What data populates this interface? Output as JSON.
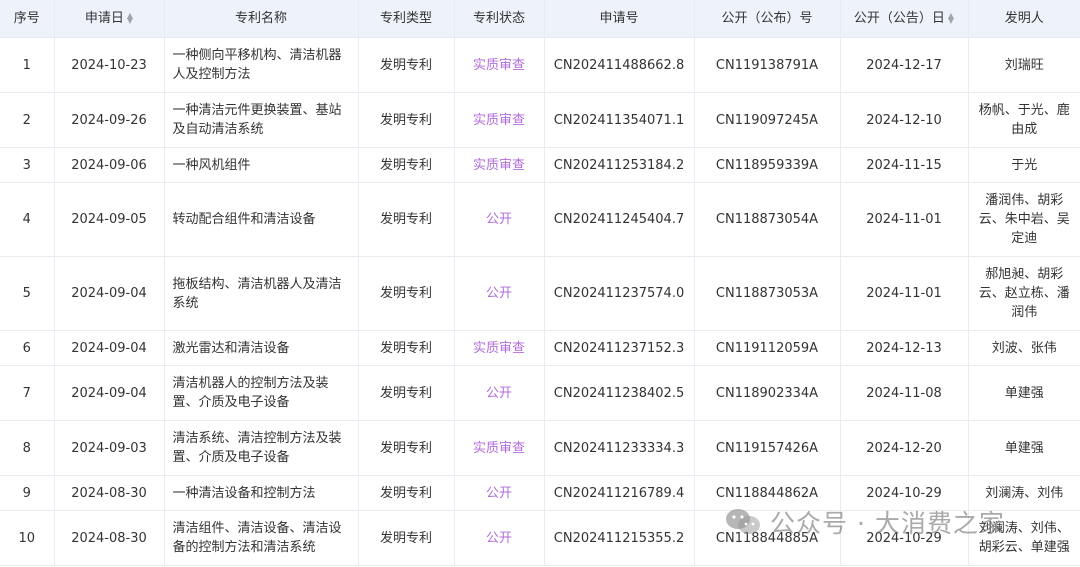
{
  "columns": [
    {
      "label": "序号",
      "sortable": false
    },
    {
      "label": "申请日",
      "sortable": true
    },
    {
      "label": "专利名称",
      "sortable": false
    },
    {
      "label": "专利类型",
      "sortable": false
    },
    {
      "label": "专利状态",
      "sortable": false
    },
    {
      "label": "申请号",
      "sortable": false
    },
    {
      "label": "公开（公布）号",
      "sortable": false
    },
    {
      "label": "公开（公告）日",
      "sortable": true
    },
    {
      "label": "发明人",
      "sortable": false
    }
  ],
  "rows": [
    {
      "no": "1",
      "date": "2024-10-23",
      "name": "一种侧向平移机构、清洁机器人及控制方法",
      "type": "发明专利",
      "status": "实质审查",
      "app_no": "CN202411488662.8",
      "pub_no": "CN119138791A",
      "pub_date": "2024-12-17",
      "inventor": "刘瑞旺"
    },
    {
      "no": "2",
      "date": "2024-09-26",
      "name": "一种清洁元件更换装置、基站及自动清洁系统",
      "type": "发明专利",
      "status": "实质审查",
      "app_no": "CN202411354071.1",
      "pub_no": "CN119097245A",
      "pub_date": "2024-12-10",
      "inventor": "杨帆、于光、鹿由成"
    },
    {
      "no": "3",
      "date": "2024-09-06",
      "name": "一种风机组件",
      "type": "发明专利",
      "status": "实质审查",
      "app_no": "CN202411253184.2",
      "pub_no": "CN118959339A",
      "pub_date": "2024-11-15",
      "inventor": "于光"
    },
    {
      "no": "4",
      "date": "2024-09-05",
      "name": "转动配合组件和清洁设备",
      "type": "发明专利",
      "status": "公开",
      "app_no": "CN202411245404.7",
      "pub_no": "CN118873054A",
      "pub_date": "2024-11-01",
      "inventor": "潘润伟、胡彩云、朱中岩、吴定迪"
    },
    {
      "no": "5",
      "date": "2024-09-04",
      "name": "拖板结构、清洁机器人及清洁系统",
      "type": "发明专利",
      "status": "公开",
      "app_no": "CN202411237574.0",
      "pub_no": "CN118873053A",
      "pub_date": "2024-11-01",
      "inventor": "郝旭昶、胡彩云、赵立栋、潘润伟"
    },
    {
      "no": "6",
      "date": "2024-09-04",
      "name": "激光雷达和清洁设备",
      "type": "发明专利",
      "status": "实质审查",
      "app_no": "CN202411237152.3",
      "pub_no": "CN119112059A",
      "pub_date": "2024-12-13",
      "inventor": "刘波、张伟"
    },
    {
      "no": "7",
      "date": "2024-09-04",
      "name": "清洁机器人的控制方法及装置、介质及电子设备",
      "type": "发明专利",
      "status": "公开",
      "app_no": "CN202411238402.5",
      "pub_no": "CN118902334A",
      "pub_date": "2024-11-08",
      "inventor": "单建强"
    },
    {
      "no": "8",
      "date": "2024-09-03",
      "name": "清洁系统、清洁控制方法及装置、介质及电子设备",
      "type": "发明专利",
      "status": "实质审查",
      "app_no": "CN202411233334.3",
      "pub_no": "CN119157426A",
      "pub_date": "2024-12-20",
      "inventor": "单建强"
    },
    {
      "no": "9",
      "date": "2024-08-30",
      "name": "一种清洁设备和控制方法",
      "type": "发明专利",
      "status": "公开",
      "app_no": "CN202411216789.4",
      "pub_no": "CN118844862A",
      "pub_date": "2024-10-29",
      "inventor": "刘澜涛、刘伟"
    },
    {
      "no": "10",
      "date": "2024-08-30",
      "name": "清洁组件、清洁设备、清洁设备的控制方法和清洁系统",
      "type": "发明专利",
      "status": "公开",
      "app_no": "CN202411215355.2",
      "pub_no": "CN118844885A",
      "pub_date": "2024-10-29",
      "inventor": "刘澜涛、刘伟、胡彩云、单建强"
    }
  ],
  "watermark": {
    "text": "公众号 · 大消费之家",
    "icon": "wechat-icon"
  },
  "colors": {
    "header_bg": "#eef3fb",
    "status_text": "#b26ddb",
    "border": "#e8ebf0",
    "text": "#333333"
  }
}
